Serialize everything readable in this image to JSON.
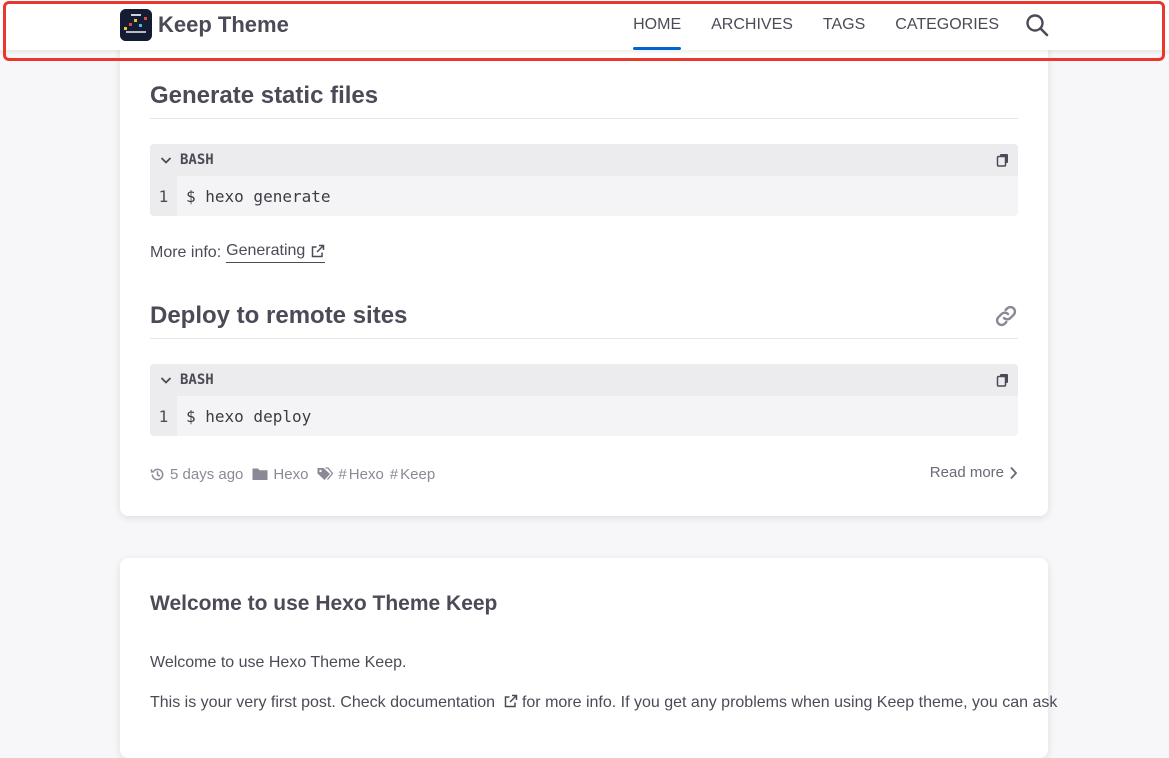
{
  "header": {
    "brand_name": "Keep Theme",
    "nav": [
      {
        "label": "HOME",
        "active": true
      },
      {
        "label": "ARCHIVES",
        "active": false
      },
      {
        "label": "TAGS",
        "active": false
      },
      {
        "label": "CATEGORIES",
        "active": false
      }
    ],
    "search_icon": "search-icon",
    "accent_color": "#0066cc",
    "highlight_outline_color": "#e8382d"
  },
  "post1": {
    "section1_title": "Generate static files",
    "code1": {
      "language": "BASH",
      "line_number": "1",
      "code": "$ hexo generate"
    },
    "more_info_label": "More info:",
    "more_info_link": "Generating",
    "section2_title": "Deploy to remote sites",
    "code2": {
      "language": "BASH",
      "line_number": "1",
      "code": "$ hexo deploy"
    },
    "meta": {
      "time": "5 days ago",
      "category": "Hexo",
      "tag_hash": "#",
      "tags": [
        "Hexo",
        "Keep"
      ]
    },
    "read_more": "Read more"
  },
  "post2": {
    "title": "Welcome to use Hexo Theme Keep",
    "paragraph1": "Welcome to use Hexo Theme Keep.",
    "paragraph2_start": "This is your very first post. Check",
    "paragraph2_link": "documentation",
    "paragraph2_end": "for more info. If you get any problems when using Keep theme, you can ask"
  }
}
